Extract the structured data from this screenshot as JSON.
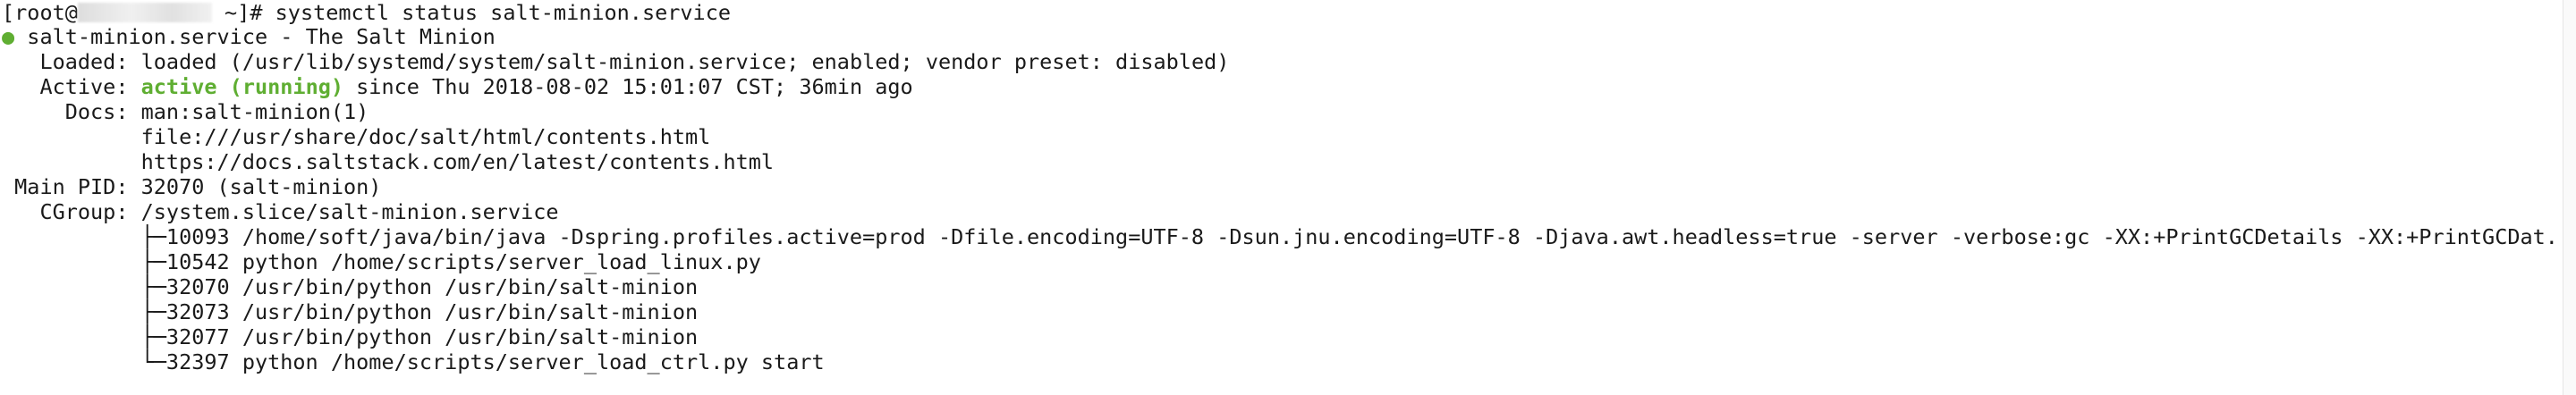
{
  "prompt": {
    "open_bracket": "[",
    "user": "root@",
    "host_redacted": "",
    "dir_suffix": " ~]# ",
    "command": "systemctl status salt-minion.service"
  },
  "unit": {
    "bullet": "●",
    "header": " salt-minion.service - The Salt Minion"
  },
  "loaded": {
    "label": "   Loaded: ",
    "value": "loaded (/usr/lib/systemd/system/salt-minion.service; enabled; vendor preset: disabled)"
  },
  "active": {
    "label": "   Active: ",
    "state": "active (running)",
    "since": " since Thu 2018-08-02 15:01:07 CST; 36min ago"
  },
  "docs": {
    "label": "     Docs: ",
    "lines": [
      "man:salt-minion(1)",
      "file:///usr/share/doc/salt/html/contents.html",
      "https://docs.saltstack.com/en/latest/contents.html"
    ],
    "indent": "           "
  },
  "main_pid": {
    "label": " Main PID: ",
    "value": "32070 (salt-minion)"
  },
  "cgroup": {
    "label": "   CGroup: ",
    "value": "/system.slice/salt-minion.service",
    "processes": [
      "           ├─10093 /home/soft/java/bin/java -Dspring.profiles.active=prod -Dfile.encoding=UTF-8 -Dsun.jnu.encoding=UTF-8 -Djava.awt.headless=true -server -verbose:gc -XX:+PrintGCDetails -XX:+PrintGCDat...",
      "           ├─10542 python /home/scripts/server_load_linux.py",
      "           ├─32070 /usr/bin/python /usr/bin/salt-minion",
      "           ├─32073 /usr/bin/python /usr/bin/salt-minion",
      "           ├─32077 /usr/bin/python /usr/bin/salt-minion",
      "           └─32397 python /home/scripts/server_load_ctrl.py start"
    ]
  },
  "colors": {
    "background": "#ffffff",
    "text": "#1a1a1a",
    "active_green": "#5fae32"
  }
}
